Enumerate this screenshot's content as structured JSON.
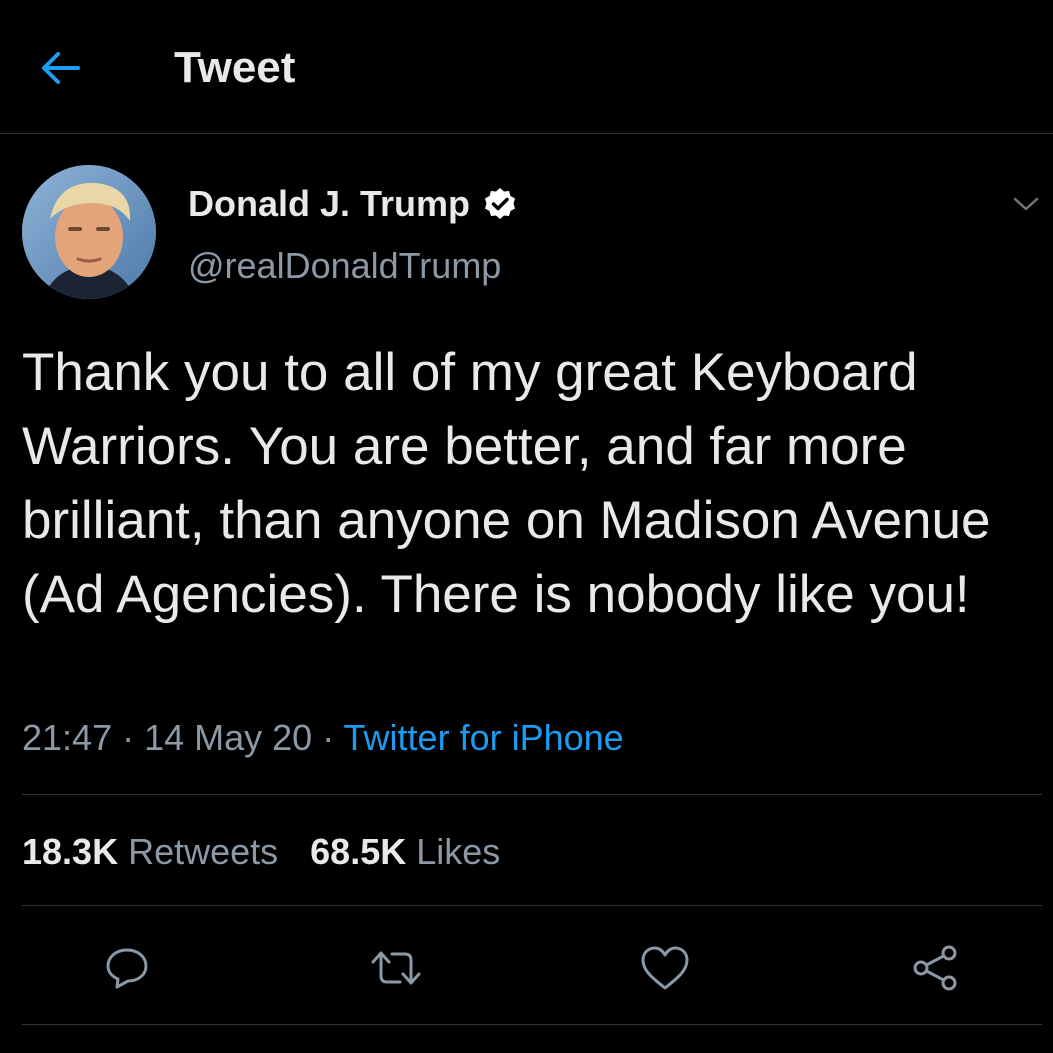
{
  "header": {
    "title": "Tweet",
    "back_icon": "arrow-left-icon"
  },
  "tweet": {
    "author": {
      "name": "Donald J. Trump",
      "handle": "@realDonaldTrump",
      "verified": true
    },
    "text": "Thank you to all of my great Keyboard Warriors. You are better, and far more brilliant, than anyone on Madison Avenue (Ad Agencies). There is nobody like you!",
    "time": "21:47",
    "date": "14 May 20",
    "separator": " · ",
    "source": "Twitter for iPhone"
  },
  "stats": {
    "retweets_count": "18.3K",
    "retweets_label": "Retweets",
    "likes_count": "68.5K",
    "likes_label": "Likes"
  },
  "actions": {
    "reply_icon": "reply-icon",
    "retweet_icon": "retweet-icon",
    "like_icon": "heart-icon",
    "share_icon": "share-icon"
  },
  "colors": {
    "background": "#000000",
    "accent": "#1d9bf0",
    "text": "#e7e9ea",
    "secondary": "#8b98a5",
    "divider": "#2f3336"
  }
}
